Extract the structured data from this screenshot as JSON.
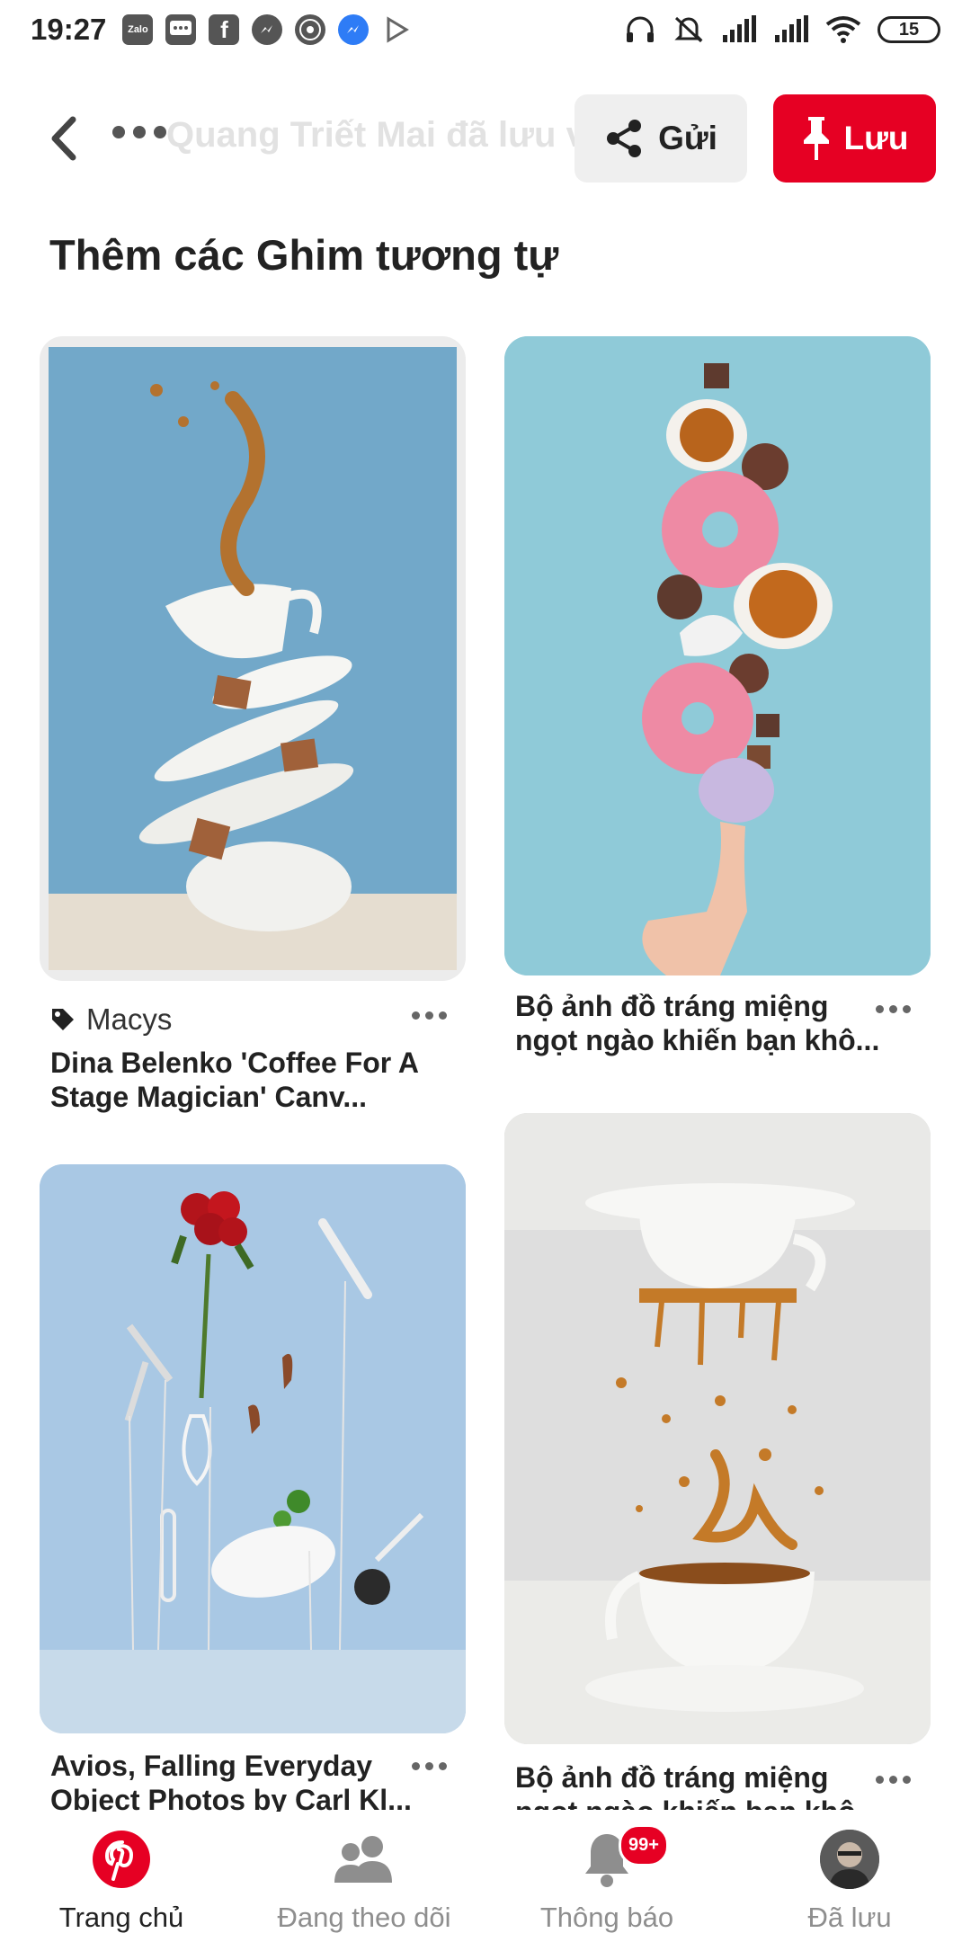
{
  "status_bar": {
    "time": "19:27",
    "apps": [
      "Zalo",
      "messages-icon",
      "facebook-icon",
      "messenger-icon",
      "chrome-icon",
      "messenger-lite-icon",
      "play-store-icon"
    ],
    "battery": "15"
  },
  "header": {
    "faded_caption": "Quang Triết Mai đã lưu vào P",
    "send_label": "Gửi",
    "save_label": "Lưu"
  },
  "section": {
    "title": "Thêm các Ghim tương tự"
  },
  "pins": [
    {
      "source": "Macys",
      "title": "Dina Belenko 'Coffee For A Stage Magician' Canv..."
    },
    {
      "title": "Bộ ảnh đồ tráng miệng ngọt ngào khiến bạn khô..."
    },
    {
      "title": "Avios, Falling Everyday Object Photos by Carl Kl..."
    },
    {
      "title": "Bộ ảnh đồ tráng miệng ngọt ngào khiến bạn khô..."
    }
  ],
  "bottom_nav": {
    "home": "Trang chủ",
    "following": "Đang theo dõi",
    "notifications": "Thông báo",
    "notifications_badge": "99+",
    "saved": "Đã lưu"
  },
  "colors": {
    "brand_red": "#e60023",
    "secondary_button_bg": "#efefef"
  }
}
